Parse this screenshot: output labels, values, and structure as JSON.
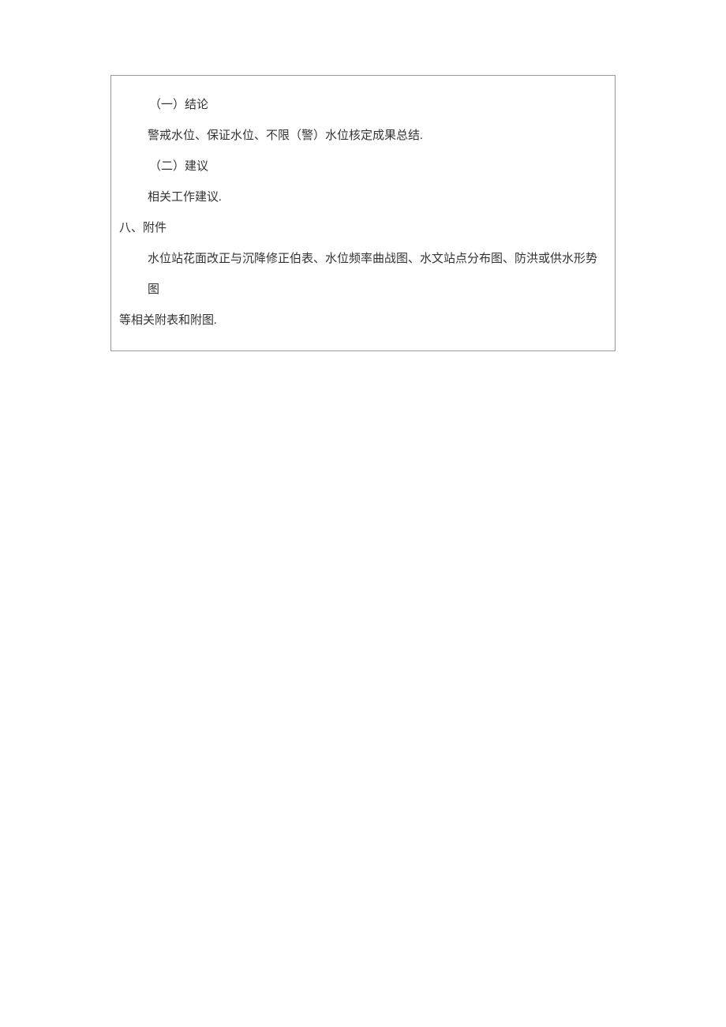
{
  "content": {
    "line1": "（一）结论",
    "line2": "警戒水位、保证水位、不限（警）水位核定成果总结.",
    "line3": "（二）建议",
    "line4": "相关工作建议.",
    "line5": "八、附件",
    "line6": "水位站花面改正与沉降修正伯表、水位频率曲战图、水文站点分布图、防洪或供水形势图",
    "line7": "等相关附表和附图."
  }
}
